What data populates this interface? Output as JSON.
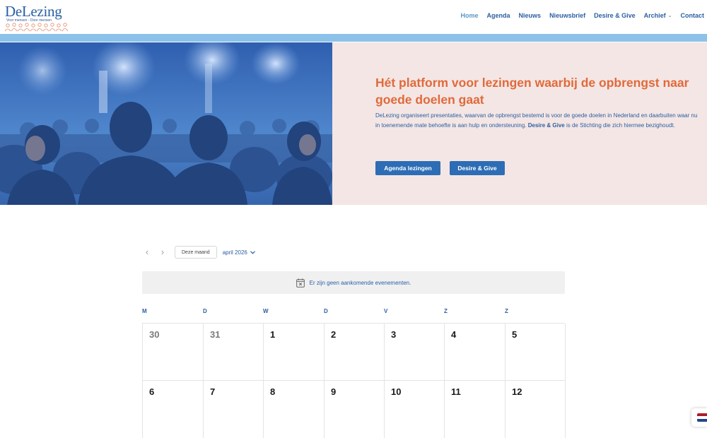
{
  "logo": {
    "title": "DeLezing",
    "tagline": "Voor mensen - Door mensen"
  },
  "nav": {
    "items": [
      {
        "label": "Home",
        "active": true
      },
      {
        "label": "Agenda",
        "active": false
      },
      {
        "label": "Nieuws",
        "active": false
      },
      {
        "label": "Nieuwsbrief",
        "active": false
      },
      {
        "label": "Desire & Give",
        "active": false
      },
      {
        "label": "Archief",
        "active": false,
        "dropdown": true
      },
      {
        "label": "Contact",
        "active": false
      }
    ]
  },
  "hero": {
    "title": "Hét platform voor lezingen waarbij de opbrengst naar goede doelen gaat",
    "description_part1": "DeLezing organiseert presentaties, waarvan de opbrengst bestemd is voor de goede doelen in Nederland en daarbuiten waar nu in toenemende mate behoefte is aan hulp en ondersteuning. ",
    "description_bold": "Desire & Give",
    "description_part2": " is de Stichting die zich hiermee bezighoudt.",
    "button_agenda": "Agenda lezingen",
    "button_desire": "Desire & Give"
  },
  "calendar": {
    "this_month_label": "Deze maand",
    "month_label": "april 2026",
    "notice": "Er zijn geen aankomende evenementen.",
    "weekdays": [
      "M",
      "D",
      "W",
      "D",
      "V",
      "Z",
      "Z"
    ],
    "weeks": [
      [
        {
          "day": "30",
          "past": true
        },
        {
          "day": "31",
          "past": true
        },
        {
          "day": "1"
        },
        {
          "day": "2"
        },
        {
          "day": "3"
        },
        {
          "day": "4"
        },
        {
          "day": "5"
        }
      ],
      [
        {
          "day": "6"
        },
        {
          "day": "7"
        },
        {
          "day": "8"
        },
        {
          "day": "9"
        },
        {
          "day": "10"
        },
        {
          "day": "11"
        },
        {
          "day": "12"
        }
      ]
    ]
  },
  "colors": {
    "brand_blue": "#2b5fa3",
    "accent_orange": "#e06a3b",
    "button_blue": "#2d6db5",
    "hero_text_bg": "#f4e6e4",
    "strip_blue": "#8cc2ea"
  },
  "icons": {
    "prev": "chevron-left-icon",
    "next": "chevron-right-icon",
    "calendar": "calendar-x-icon",
    "language": "netherlands-flag-icon"
  }
}
